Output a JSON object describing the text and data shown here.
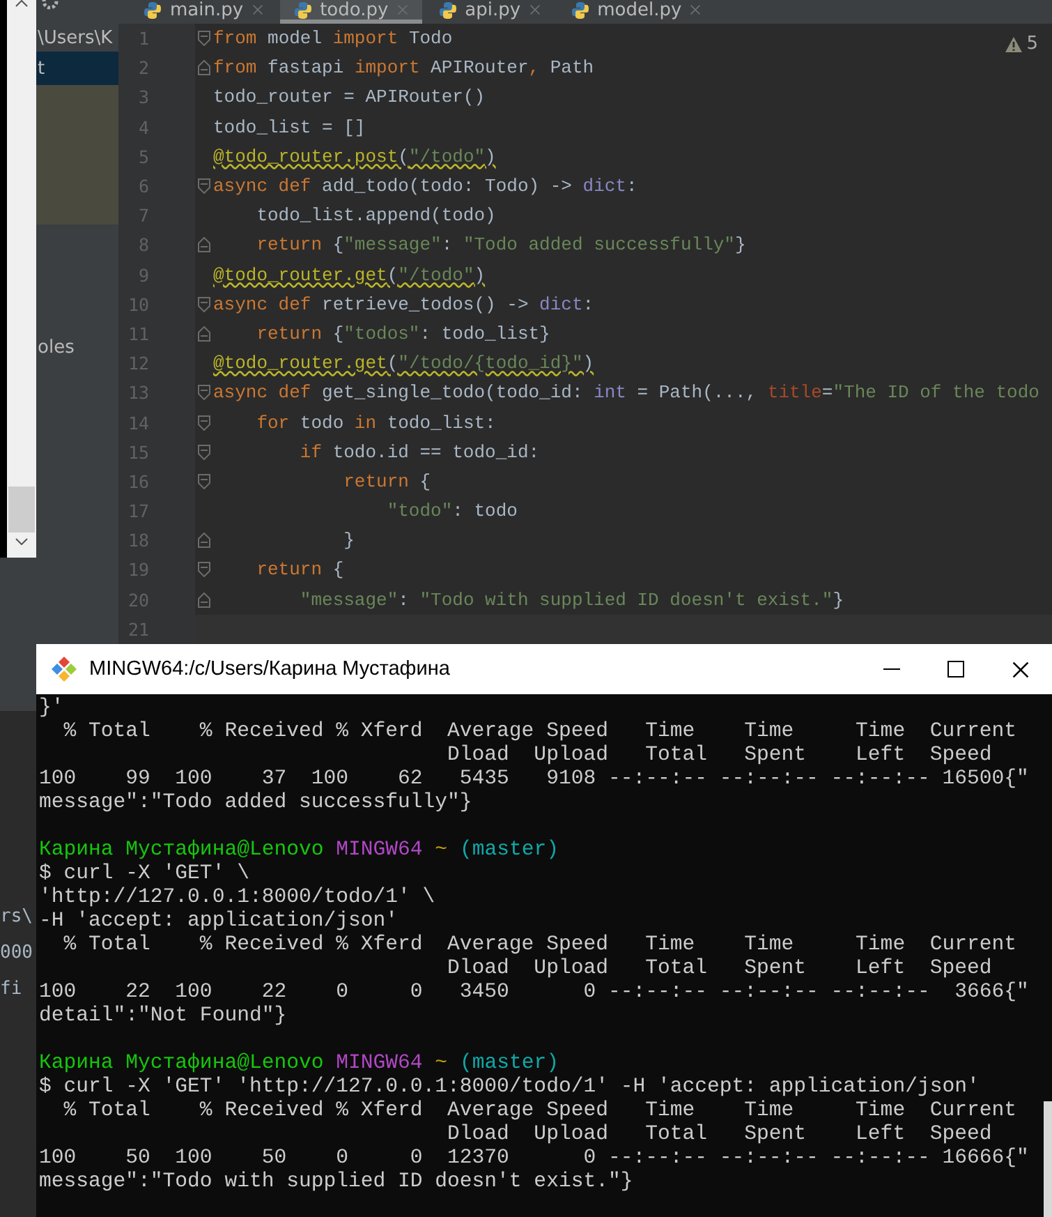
{
  "project": {
    "rows": [
      {
        "label": "\\Users\\K",
        "selected": false
      },
      {
        "label": "t",
        "selected": true
      },
      {
        "label": "oles",
        "selected": false
      }
    ]
  },
  "tabs": [
    {
      "label": "main.py",
      "selected": false
    },
    {
      "label": "todo.py",
      "selected": true
    },
    {
      "label": "api.py",
      "selected": false
    },
    {
      "label": "model.py",
      "selected": false
    }
  ],
  "warnings": "5",
  "code_lines": [
    {
      "number": "1",
      "kind": "fold-start",
      "current": false,
      "underlined": false,
      "tokens": [
        {
          "kind": "keyword",
          "text": "from"
        },
        {
          "kind": "plain",
          "text": " model "
        },
        {
          "kind": "keyword",
          "text": "import"
        },
        {
          "kind": "plain",
          "text": " Todo"
        }
      ]
    },
    {
      "number": "2",
      "kind": "fold-end",
      "current": false,
      "underlined": false,
      "tokens": [
        {
          "kind": "keyword",
          "text": "from"
        },
        {
          "kind": "plain",
          "text": " fastapi "
        },
        {
          "kind": "keyword",
          "text": "import"
        },
        {
          "kind": "plain",
          "text": " APIRouter"
        },
        {
          "kind": "keyword",
          "text": ","
        },
        {
          "kind": "plain",
          "text": " Path"
        }
      ]
    },
    {
      "number": "3",
      "kind": "plain",
      "current": false,
      "underlined": false,
      "tokens": [
        {
          "kind": "plain",
          "text": "todo_router = APIRouter()"
        }
      ]
    },
    {
      "number": "4",
      "kind": "plain",
      "current": false,
      "underlined": false,
      "tokens": [
        {
          "kind": "plain",
          "text": "todo_list = []"
        }
      ]
    },
    {
      "number": "5",
      "kind": "plain",
      "current": false,
      "underlined": true,
      "tokens": [
        {
          "kind": "decorator",
          "text": "@todo_router.post"
        },
        {
          "kind": "plain",
          "text": "("
        },
        {
          "kind": "string",
          "text": "\"/todo\""
        },
        {
          "kind": "plain",
          "text": ")"
        }
      ]
    },
    {
      "number": "6",
      "kind": "fold-start",
      "current": false,
      "underlined": false,
      "tokens": [
        {
          "kind": "keyword",
          "text": "async def"
        },
        {
          "kind": "plain",
          "text": " add_todo(todo: Todo) -> "
        },
        {
          "kind": "builtin",
          "text": "dict"
        },
        {
          "kind": "plain",
          "text": ":"
        }
      ]
    },
    {
      "number": "7",
      "kind": "plain",
      "current": false,
      "underlined": false,
      "tokens": [
        {
          "kind": "plain",
          "text": "    todo_list.append(todo)"
        }
      ]
    },
    {
      "number": "8",
      "kind": "fold-end",
      "current": false,
      "underlined": false,
      "tokens": [
        {
          "kind": "keyword",
          "text": "    return"
        },
        {
          "kind": "plain",
          "text": " {"
        },
        {
          "kind": "string",
          "text": "\"message\""
        },
        {
          "kind": "plain",
          "text": ": "
        },
        {
          "kind": "string",
          "text": "\"Todo added successfully\""
        },
        {
          "kind": "plain",
          "text": "}"
        }
      ]
    },
    {
      "number": "9",
      "kind": "plain",
      "current": false,
      "underlined": true,
      "tokens": [
        {
          "kind": "decorator",
          "text": "@todo_router.get"
        },
        {
          "kind": "plain",
          "text": "("
        },
        {
          "kind": "string",
          "text": "\"/todo\""
        },
        {
          "kind": "plain",
          "text": ")"
        }
      ]
    },
    {
      "number": "10",
      "kind": "fold-start",
      "current": false,
      "underlined": false,
      "tokens": [
        {
          "kind": "keyword",
          "text": "async def"
        },
        {
          "kind": "plain",
          "text": " retrieve_todos() -> "
        },
        {
          "kind": "builtin",
          "text": "dict"
        },
        {
          "kind": "plain",
          "text": ":"
        }
      ]
    },
    {
      "number": "11",
      "kind": "fold-end",
      "current": false,
      "underlined": false,
      "tokens": [
        {
          "kind": "keyword",
          "text": "    return"
        },
        {
          "kind": "plain",
          "text": " {"
        },
        {
          "kind": "string",
          "text": "\"todos\""
        },
        {
          "kind": "plain",
          "text": ": todo_list}"
        }
      ]
    },
    {
      "number": "12",
      "kind": "plain",
      "current": false,
      "underlined": true,
      "tokens": [
        {
          "kind": "decorator",
          "text": "@todo_router.get"
        },
        {
          "kind": "plain",
          "text": "("
        },
        {
          "kind": "string",
          "text": "\"/todo/{todo_id}\""
        },
        {
          "kind": "plain",
          "text": ")"
        }
      ]
    },
    {
      "number": "13",
      "kind": "fold-start",
      "current": false,
      "underlined": false,
      "tokens": [
        {
          "kind": "keyword",
          "text": "async def"
        },
        {
          "kind": "plain",
          "text": " get_single_todo(todo_id: "
        },
        {
          "kind": "builtin",
          "text": "int"
        },
        {
          "kind": "plain",
          "text": " = Path(..., "
        },
        {
          "kind": "param",
          "text": "title"
        },
        {
          "kind": "plain",
          "text": "="
        },
        {
          "kind": "string",
          "text": "\"The ID of the todo"
        }
      ]
    },
    {
      "number": "14",
      "kind": "fold-start",
      "current": false,
      "underlined": false,
      "tokens": [
        {
          "kind": "keyword",
          "text": "    for"
        },
        {
          "kind": "plain",
          "text": " todo "
        },
        {
          "kind": "keyword",
          "text": "in"
        },
        {
          "kind": "plain",
          "text": " todo_list:"
        }
      ]
    },
    {
      "number": "15",
      "kind": "fold-start",
      "current": false,
      "underlined": false,
      "tokens": [
        {
          "kind": "keyword",
          "text": "        if"
        },
        {
          "kind": "plain",
          "text": " todo.id == todo_id:"
        }
      ]
    },
    {
      "number": "16",
      "kind": "fold-start",
      "current": false,
      "underlined": false,
      "tokens": [
        {
          "kind": "keyword",
          "text": "            return"
        },
        {
          "kind": "plain",
          "text": " {"
        }
      ]
    },
    {
      "number": "17",
      "kind": "plain",
      "current": false,
      "underlined": false,
      "tokens": [
        {
          "kind": "string",
          "text": "                \"todo\""
        },
        {
          "kind": "plain",
          "text": ": todo"
        }
      ]
    },
    {
      "number": "18",
      "kind": "fold-end",
      "current": false,
      "underlined": false,
      "tokens": [
        {
          "kind": "plain",
          "text": "            }"
        }
      ]
    },
    {
      "number": "19",
      "kind": "fold-start",
      "current": false,
      "underlined": false,
      "tokens": [
        {
          "kind": "keyword",
          "text": "    return"
        },
        {
          "kind": "plain",
          "text": " {"
        }
      ]
    },
    {
      "number": "20",
      "kind": "fold-end",
      "current": false,
      "underlined": false,
      "tokens": [
        {
          "kind": "string",
          "text": "        \"message\""
        },
        {
          "kind": "plain",
          "text": ": "
        },
        {
          "kind": "string",
          "text": "\"Todo with supplied ID doesn't exist.\""
        },
        {
          "kind": "plain",
          "text": "}"
        }
      ]
    },
    {
      "number": "21",
      "kind": "plain",
      "current": true
    }
  ],
  "bottom_panel": {
    "fragments": [
      "rs\\",
      "000",
      "fi"
    ]
  },
  "terminal": {
    "title": "MINGW64:/c/Users/Карина Мустафина",
    "lines": [
      {
        "kind": "output",
        "segments": [
          {
            "kind": "output",
            "text": "}'"
          }
        ]
      },
      {
        "kind": "output",
        "segments": [
          {
            "kind": "output",
            "text": "  % Total    % Received % Xferd  Average Speed   Time    Time     Time  Current"
          }
        ]
      },
      {
        "kind": "output",
        "segments": [
          {
            "kind": "output",
            "text": "                                 Dload  Upload   Total   Spent    Left  Speed"
          }
        ]
      },
      {
        "kind": "output",
        "segments": [
          {
            "kind": "output",
            "text": "100    99  100    37  100    62   5435   9108 --:--:-- --:--:-- --:--:-- 16500{\""
          }
        ]
      },
      {
        "kind": "output",
        "segments": [
          {
            "kind": "output",
            "text": "message\":\"Todo added successfully\"}"
          }
        ]
      },
      {
        "kind": "prompt",
        "segments": [
          {
            "kind": "user",
            "text": "Карина Мустафина@Lenovo "
          },
          {
            "kind": "system",
            "text": "MINGW64 "
          },
          {
            "kind": "path",
            "text": "~ "
          },
          {
            "kind": "branch",
            "text": "(master)"
          }
        ]
      },
      {
        "kind": "output",
        "segments": [
          {
            "kind": "output",
            "text": "$ curl -X 'GET' \\"
          }
        ]
      },
      {
        "kind": "output",
        "segments": [
          {
            "kind": "output",
            "text": "'http://127.0.0.1:8000/todo/1' \\"
          }
        ]
      },
      {
        "kind": "output",
        "segments": [
          {
            "kind": "output",
            "text": "-H 'accept: application/json'"
          }
        ]
      },
      {
        "kind": "output",
        "segments": [
          {
            "kind": "output",
            "text": "  % Total    % Received % Xferd  Average Speed   Time    Time     Time  Current"
          }
        ]
      },
      {
        "kind": "output",
        "segments": [
          {
            "kind": "output",
            "text": "                                 Dload  Upload   Total   Spent    Left  Speed"
          }
        ]
      },
      {
        "kind": "output",
        "segments": [
          {
            "kind": "output",
            "text": "100    22  100    22    0     0   3450      0 --:--:-- --:--:-- --:--:--  3666{\""
          }
        ]
      },
      {
        "kind": "output",
        "segments": [
          {
            "kind": "output",
            "text": "detail\":\"Not Found\"}"
          }
        ]
      },
      {
        "kind": "prompt",
        "segments": [
          {
            "kind": "user",
            "text": "Карина Мустафина@Lenovo "
          },
          {
            "kind": "system",
            "text": "MINGW64 "
          },
          {
            "kind": "path",
            "text": "~ "
          },
          {
            "kind": "branch",
            "text": "(master)"
          }
        ]
      },
      {
        "kind": "output",
        "segments": [
          {
            "kind": "output",
            "text": "$ curl -X 'GET' 'http://127.0.0.1:8000/todo/1' -H 'accept: application/json'"
          }
        ]
      },
      {
        "kind": "output",
        "segments": [
          {
            "kind": "output",
            "text": "  % Total    % Received % Xferd  Average Speed   Time    Time     Time  Current"
          }
        ]
      },
      {
        "kind": "output",
        "segments": [
          {
            "kind": "output",
            "text": "                                 Dload  Upload   Total   Spent    Left  Speed"
          }
        ]
      },
      {
        "kind": "output",
        "segments": [
          {
            "kind": "output",
            "text": "100    50  100    50    0     0  12370      0 --:--:-- --:--:-- --:--:-- 16666{\""
          }
        ]
      },
      {
        "kind": "output",
        "segments": [
          {
            "kind": "output",
            "text": "message\":\"Todo with supplied ID doesn't exist.\"}"
          }
        ]
      }
    ]
  }
}
